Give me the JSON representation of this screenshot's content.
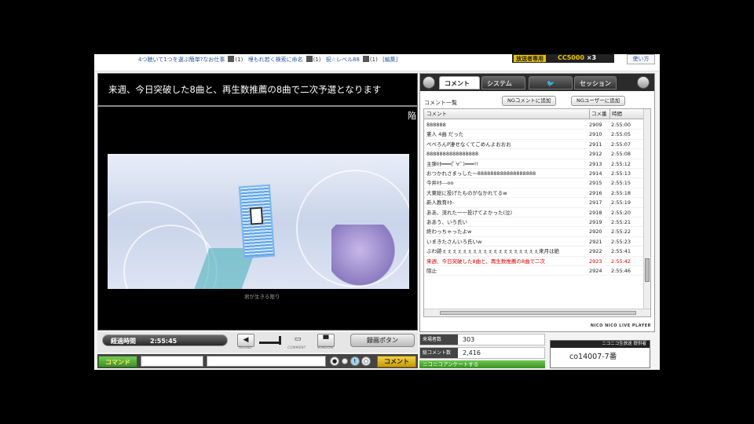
{
  "topbar": {
    "ticker": [
      {
        "text": "4つ聴いて1つを選ぶ簡単?なお仕事",
        "count": "(1)"
      },
      {
        "text": "埋もれ若く検索に命名",
        "count": "(1)"
      },
      {
        "text": "祝☆レベル88",
        "count": "(1)"
      }
    ],
    "edit_label": "[編集]",
    "ad_label": "放送者専用",
    "ad_code": "CC5000",
    "ad_multiplier": "×3",
    "howto_label": "使い方"
  },
  "player": {
    "telop": "来週、今日突破した8曲と、再生数推薦の8曲で二次予選となります",
    "telop_edge": "陥",
    "video_caption": "君が生きる限り"
  },
  "controls": {
    "elapsed_label": "経過時間",
    "elapsed_time": "2:55:45",
    "sound_label": "SOUND",
    "comment_label": "COMMENT",
    "window_label": "WINDOW",
    "rec_button": "録画ボタン"
  },
  "command": {
    "command_button": "コマンド",
    "send_button": "コメント"
  },
  "panel": {
    "tabs": [
      "コメント",
      "システム",
      "",
      "セッション"
    ],
    "list_title": "コメント一覧",
    "ng_comment_button": "NGコメントに追加",
    "ng_user_button": "NGユーザーに追加",
    "columns": {
      "comment": "コメント",
      "no": "コメ番",
      "time": "時間"
    },
    "comments": [
      {
        "text": "888888",
        "no": "2909",
        "time": "2:55:00",
        "red": false
      },
      {
        "text": "憲人 4曲 だった",
        "no": "2910",
        "time": "2:55:05",
        "red": false
      },
      {
        "text": "ぺぺろんP凄せなくてごめんよおおお",
        "no": "2911",
        "time": "2:55:07",
        "red": false
      },
      {
        "text": "8888888888888888",
        "no": "2912",
        "time": "2:55:08",
        "red": false
      },
      {
        "text": "主弾ｷﾀ━━━(ﾟ∀ﾟ)━━━!!",
        "no": "2913",
        "time": "2:55:12",
        "red": false
      },
      {
        "text": "おつかれさまっした～888888888888888888",
        "no": "2914",
        "time": "2:55:13",
        "red": false
      },
      {
        "text": "今井ｷﾀ---oo",
        "no": "2915",
        "time": "2:55:15",
        "red": false
      },
      {
        "text": "大東総に投げたものがなかれてるw",
        "no": "2916",
        "time": "2:55:18",
        "red": false
      },
      {
        "text": "新人教育ｷﾀ-",
        "no": "2917",
        "time": "2:55:19",
        "red": false
      },
      {
        "text": "ああ、流れた一一投げてよかった(泣)",
        "no": "2918",
        "time": "2:55:20",
        "red": false
      },
      {
        "text": "ああう、いろ氏い",
        "no": "2919",
        "time": "2:55:21",
        "red": false
      },
      {
        "text": "終わっちゃったよw",
        "no": "2920",
        "time": "2:55:22",
        "red": false
      },
      {
        "text": "いまきたさんいろ氏いw",
        "no": "2921",
        "time": "2:55:23",
        "red": false
      },
      {
        "text": "ぶわ跡ぇぇぇぇぇぇぇぇぇぇぇぇぇぇぇぇぇぇぇ来月は絶",
        "no": "2922",
        "time": "2:55:41",
        "red": false
      },
      {
        "text": "来週、今日突破した8曲と、再生数推薦の8曲で二次",
        "no": "2923",
        "time": "2:55:42",
        "red": true
      },
      {
        "text": "阻止",
        "no": "2924",
        "time": "2:55:46",
        "red": false
      }
    ],
    "brand": "NICO NICO LIVE PLAYER"
  },
  "stats": {
    "viewers_label": "来場者数",
    "viewers": "303",
    "comments_label": "総コメント数",
    "comments": "2,416",
    "green_bar": "ニコニコアンケートする"
  },
  "community": {
    "header": "ニコニコ生放送 提供者",
    "id": "co14007-7番"
  }
}
